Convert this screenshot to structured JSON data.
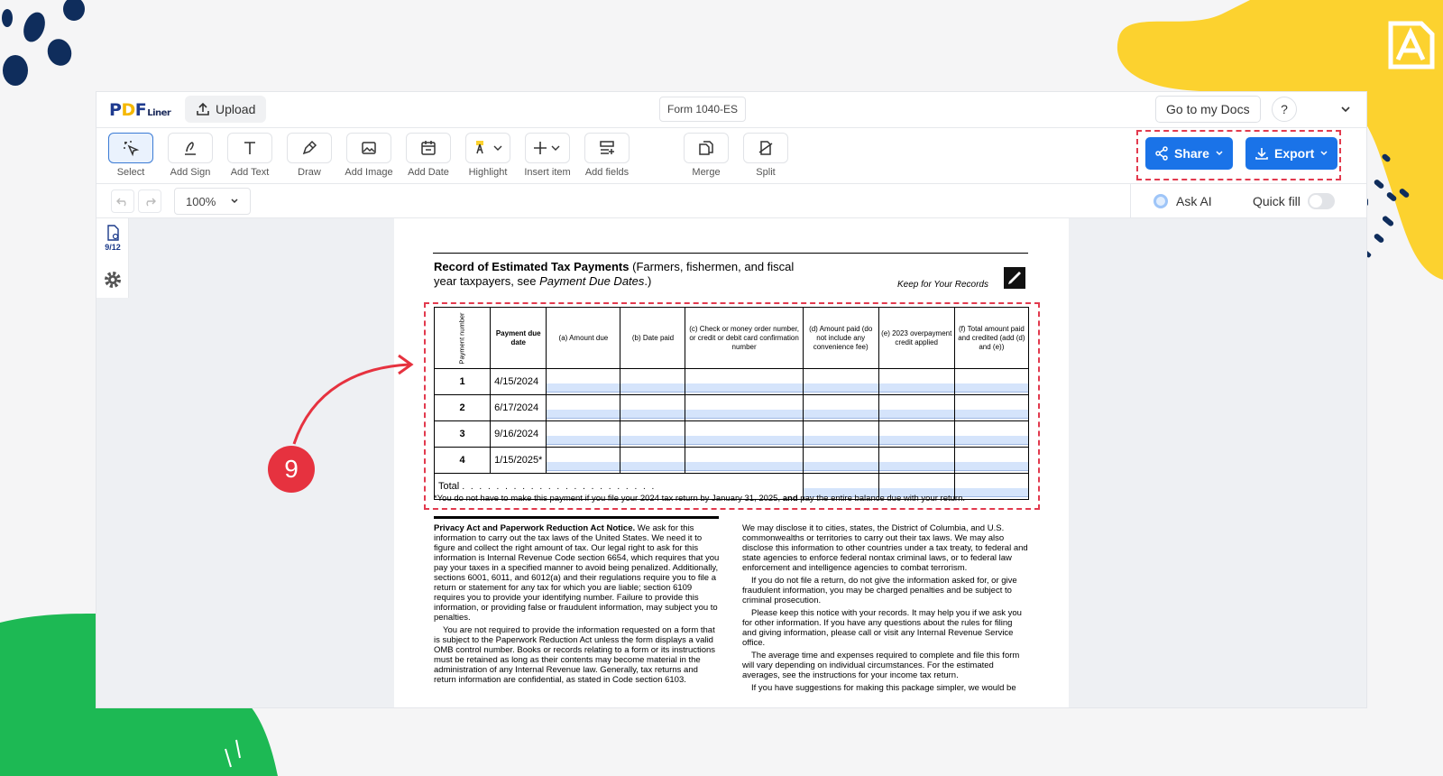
{
  "colors": {
    "accent": "#1a73e8",
    "highlight_box": "#e23a4e",
    "badge": "#e6323f",
    "deco_yellow": "#fcd22f",
    "deco_green": "#1db954",
    "deco_navy": "#0f2d5c"
  },
  "header": {
    "logo_pdf": "PDF",
    "logo_liner": "Liner",
    "upload_label": "Upload",
    "form_name": "Form 1040-ES",
    "go_to_docs": "Go to my Docs",
    "help": "?"
  },
  "toolbar": {
    "tools": [
      {
        "label": "Select",
        "icon": "select-icon"
      },
      {
        "label": "Add Sign",
        "icon": "sign-icon"
      },
      {
        "label": "Add Text",
        "icon": "text-icon"
      },
      {
        "label": "Draw",
        "icon": "pen-icon"
      },
      {
        "label": "Add Image",
        "icon": "image-icon"
      },
      {
        "label": "Add Date",
        "icon": "calendar-icon"
      },
      {
        "label": "Highlight",
        "icon": "highlight-icon"
      },
      {
        "label": "Insert item",
        "icon": "plus-icon"
      },
      {
        "label": "Add fields",
        "icon": "fields-icon"
      },
      {
        "label": "Merge",
        "icon": "merge-icon"
      },
      {
        "label": "Split",
        "icon": "split-icon"
      }
    ],
    "share_label": "Share",
    "export_label": "Export"
  },
  "subbar": {
    "zoom": "100%",
    "ask_ai": "Ask AI",
    "quick_fill": "Quick fill"
  },
  "sidebar": {
    "page_count": "9/12"
  },
  "document": {
    "title_bold": "Record of Estimated Tax Payments",
    "title_rest": " (Farmers, fishermen, and fiscal",
    "title_line2_a": "year taxpayers, see ",
    "title_line2_italic": "Payment Due Dates",
    "title_line2_b": ".)",
    "keep": "Keep for Your Records",
    "table": {
      "headers": [
        "Payment number",
        "Payment due date",
        "(a) Amount due",
        "(b) Date paid",
        "(c) Check or money order number, or credit or debit card confirmation number",
        "(d) Amount paid (do not include any convenience fee)",
        "(e) 2023 overpayment credit applied",
        "(f) Total amount paid and credited (add (d) and (e))"
      ],
      "rows": [
        {
          "num": "1",
          "date": "4/15/2024"
        },
        {
          "num": "2",
          "date": "6/17/2024"
        },
        {
          "num": "3",
          "date": "9/16/2024"
        },
        {
          "num": "4",
          "date": "1/15/2025*"
        }
      ],
      "total_label": "Total",
      "total_dots": ". . . . . . . . . . . . . . . . . . . . . . ."
    },
    "footnote_a": "*You do not have to make this payment if you file your 2024 tax return by January 31, 2025, ",
    "footnote_bold": "and",
    "footnote_b": " pay the entire balance due with your return.",
    "privacy_title": "Privacy Act and Paperwork Reduction Act Notice.",
    "privacy_p1": " We ask for this information to carry out the tax laws of the United States. We need it to figure and collect the right amount of tax. Our legal right to ask for this information is Internal Revenue Code section 6654, which requires that you pay your taxes in a specified manner to avoid being penalized. Additionally, sections 6001, 6011, and 6012(a) and their regulations require you to file a return or statement for any tax for which you are liable; section 6109 requires you to provide your identifying number. Failure to provide this information, or providing false or fraudulent information, may subject you to penalties.",
    "privacy_p2": "You are not required to provide the information requested on a form that is subject to the Paperwork Reduction Act unless the form displays a valid OMB control number. Books or records relating to a form or its instructions must be retained as long as their contents may become material in the administration of any Internal Revenue law. Generally, tax returns and return information are confidential, as stated in Code section 6103.",
    "right_p1": "We may disclose it to cities, states, the District of Columbia, and U.S. commonwealths or territories to carry out their tax laws. We may also disclose this information to other countries under a tax treaty, to federal and state agencies to enforce federal nontax criminal laws, or to federal law enforcement and intelligence agencies to combat terrorism.",
    "right_p2": "If you do not file a return, do not give the information asked for, or give fraudulent information, you may be charged penalties and be subject to criminal prosecution.",
    "right_p3": "Please keep this notice with your records. It may help you if we ask you for other information. If you have any questions about the rules for filing and giving information, please call or visit any Internal Revenue Service office.",
    "right_p4": "The average time and expenses required to complete and file this form will vary depending on individual circumstances. For the estimated averages, see the instructions for your income tax return.",
    "right_p5": "If you have suggestions for making this package simpler, we would be"
  },
  "annotation": {
    "step_number": "9"
  }
}
